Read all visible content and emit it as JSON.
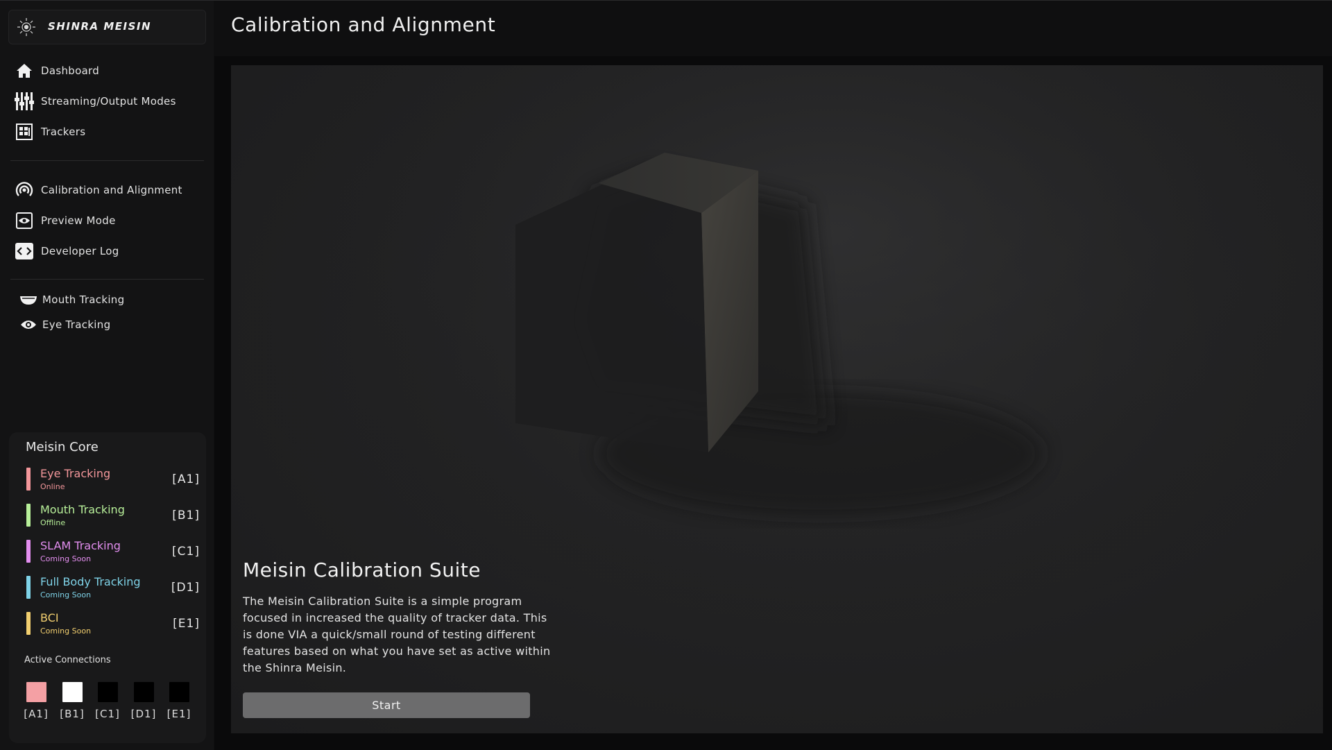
{
  "brand": {
    "name": "SHINRA MEISIN",
    "logo_icon": "sun-eye-icon"
  },
  "page_title": "Calibration and Alignment",
  "nav": {
    "group1": [
      {
        "label": "Dashboard",
        "icon": "home-icon"
      },
      {
        "label": "Streaming/Output Modes",
        "icon": "sliders-icon"
      },
      {
        "label": "Trackers",
        "icon": "grid-icon"
      }
    ],
    "group2": [
      {
        "label": "Calibration and Alignment",
        "icon": "target-icon"
      },
      {
        "label": "Preview Mode",
        "icon": "eye-box-icon"
      },
      {
        "label": "Developer Log",
        "icon": "code-icon"
      }
    ],
    "group3": [
      {
        "label": "Mouth Tracking",
        "icon": "mouth-icon"
      },
      {
        "label": "Eye Tracking",
        "icon": "eye-icon"
      }
    ]
  },
  "core": {
    "title": "Meisin Core",
    "rows": [
      {
        "name": "Eye Tracking",
        "status": "Online",
        "code": "[A1]",
        "color": "#f4979b"
      },
      {
        "name": "Mouth Tracking",
        "status": "Offline",
        "code": "[B1]",
        "color": "#b8f09a"
      },
      {
        "name": "SLAM Tracking",
        "status": "Coming Soon",
        "code": "[C1]",
        "color": "#e48ff0"
      },
      {
        "name": "Full Body Tracking",
        "status": "Coming Soon",
        "code": "[D1]",
        "color": "#7fd3e8"
      },
      {
        "name": "BCI",
        "status": "Coming Soon",
        "code": "[E1]",
        "color": "#f2cf6f"
      }
    ],
    "active_title": "Active Connections",
    "connections": [
      {
        "code": "[A1]",
        "color": "#f4a0a4"
      },
      {
        "code": "[B1]",
        "color": "#ffffff"
      },
      {
        "code": "[C1]",
        "color": "#000000"
      },
      {
        "code": "[D1]",
        "color": "#000000"
      },
      {
        "code": "[E1]",
        "color": "#000000"
      }
    ]
  },
  "suite": {
    "title": "Meisin Calibration Suite",
    "description": "The Meisin Calibration Suite is a simple program focused in increased the quality of tracker data. This is done VIA a quick/small round of testing different features based on what you have set as active within the Shinra Meisin.",
    "start_label": "Start"
  }
}
